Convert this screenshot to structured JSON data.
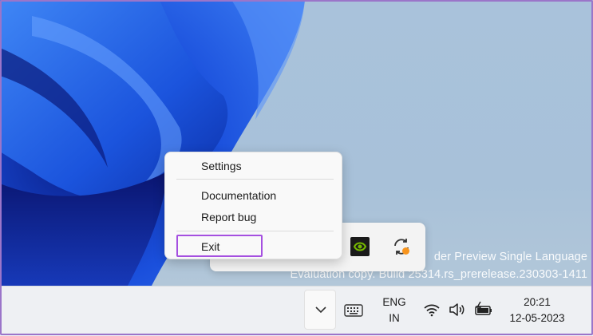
{
  "context_menu": {
    "items": [
      "Settings",
      "Documentation",
      "Report bug",
      "Exit"
    ]
  },
  "watermark": {
    "line1": "der Preview Single Language",
    "line2": "Evaluation copy. Build 25314.rs_prerelease.230303-1411"
  },
  "taskbar": {
    "language": {
      "line1": "ENG",
      "line2": "IN"
    },
    "clock": {
      "time": "20:21",
      "date": "12-05-2023"
    }
  },
  "colors": {
    "highlight_border": "#a550e0",
    "bloom_blue": "#1646d8",
    "desktop_background": "#a9c2db"
  },
  "icons": [
    "chevron-up-icon",
    "keyboard-icon",
    "wifi-icon",
    "speaker-icon",
    "battery-icon",
    "nvidia-icon",
    "sync-icon"
  ]
}
